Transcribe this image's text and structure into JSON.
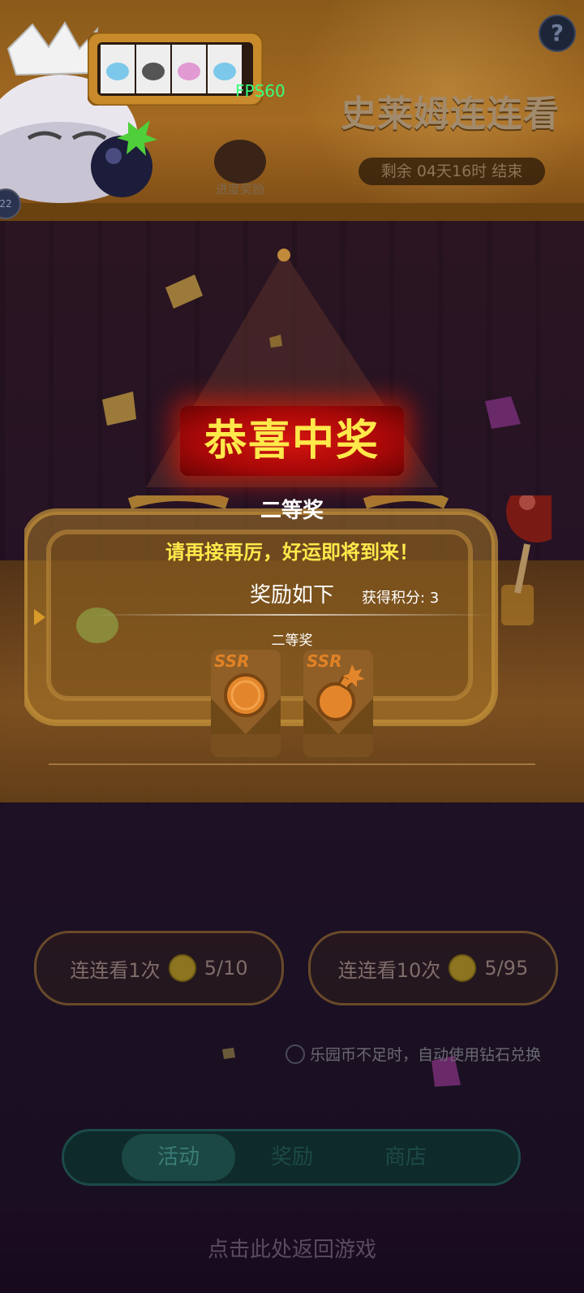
{
  "header": {
    "title": "史莱姆连连看",
    "fps": "FPS60",
    "timer": "剩余 04天16时 结束",
    "progress_reward_label": "进度奖励",
    "help_icon": "?",
    "level_badge": "22"
  },
  "popup": {
    "congrats": "恭喜中奖",
    "prize_level": "二等奖",
    "encourage": "请再接再厉，好运即将到来！",
    "rewards_title": "奖励如下",
    "points_label": "获得积分: 3",
    "tier_label": "二等奖",
    "rewards": [
      {
        "rarity": "SSR",
        "icon": "orb-icon"
      },
      {
        "rarity": "SSR",
        "icon": "bomb-icon"
      }
    ]
  },
  "actions": {
    "draw_once": {
      "label": "连连看1次",
      "count": "5/10"
    },
    "draw_ten": {
      "label": "连连看10次",
      "count": "5/95"
    },
    "auto_diamond": "乐园币不足时，自动使用钻石兑换"
  },
  "tabs": [
    {
      "label": "活动",
      "active": true
    },
    {
      "label": "奖励",
      "active": false
    },
    {
      "label": "商店",
      "active": false
    }
  ],
  "return_label": "点击此处返回游戏",
  "colors": {
    "accent_yellow": "#ffe94a",
    "congrats_red": "#c2100c",
    "fps_green": "#39ff7a",
    "ssr_orange": "#e08226"
  }
}
